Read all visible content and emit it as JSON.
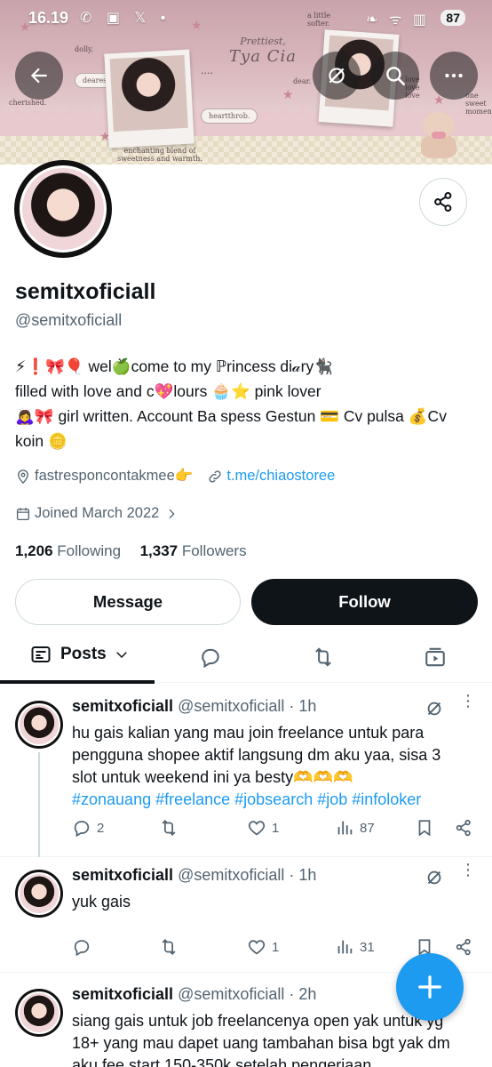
{
  "status_bar": {
    "time": "16.19",
    "battery": "87",
    "left_icons": "✆ ▣ 𝕏 •",
    "right_icons": "❧ ᯤ ▥"
  },
  "banner": {
    "title_line1": "Prettiest,",
    "title_line2": "Tya Cia",
    "texts": {
      "dolly": "dolly.",
      "cherished": "cherished.",
      "dearest": "dearest",
      "a_little_softer": "a little softer.",
      "dear": "dear.",
      "heartthrob": "heartthrob.",
      "enchanting": "enchanting blend of sweetness and warmth.",
      "love": "love love love",
      "one_sweet": "one sweet moment",
      "ellipsis": "...."
    }
  },
  "header": {
    "back_icon": "arrow-left-icon",
    "grok_icon": "grok-icon",
    "search_icon": "search-icon",
    "more_icon": "more-horizontal-icon"
  },
  "profile": {
    "display_name": "semitxoficiall",
    "handle": "@semitxoficiall",
    "bio_line1": "⚡❗🎀🎈 wel🍏come to my ℙrincess di𝒶ry🐈‍⬛",
    "bio_line2": "filled with love and c💖lours 🧁⭐ pink lover",
    "bio_line3": "🙇‍♀️🎀 girl written. Account Ba spess Gestun 💳 Cv pulsa 💰Cv koin 🪙",
    "location": "fastresponcontakmee👉",
    "website": "t.me/chiaostoree",
    "joined": "Joined March 2022",
    "following_count": "1,206",
    "following_label": "Following",
    "followers_count": "1,337",
    "followers_label": "Followers"
  },
  "buttons": {
    "message": "Message",
    "follow": "Follow"
  },
  "tabs": {
    "posts_label": "Posts"
  },
  "posts": [
    {
      "name": "semitxoficiall",
      "handle": "@semitxoficiall",
      "time": "· 1h",
      "text": "hu gais kalian yang mau join freelance untuk para pengguna shopee aktif langsung dm aku yaa, sisa 3 slot untuk weekend ini ya besty🫶🫶🫶",
      "tags": "#zonauang #freelance #jobsearch #job #infoloker",
      "replies": "2",
      "reposts": "",
      "likes": "1",
      "views": "87"
    },
    {
      "name": "semitxoficiall",
      "handle": "@semitxoficiall",
      "time": "· 1h",
      "text": "yuk gais",
      "replies": "",
      "reposts": "",
      "likes": "1",
      "views": "31"
    },
    {
      "name": "semitxoficiall",
      "handle": "@semitxoficiall",
      "time": "· 2h",
      "text": "siang gais untuk job freelancenya open yak untuk yg 18+ yang mau dapet uang tambahan bisa bgt yak dm aku fee start 150-350k setelah pengerjaan"
    }
  ],
  "colors": {
    "accent": "#1d9bf0",
    "text_primary": "#0f1419",
    "text_secondary": "#536471",
    "follow_bg": "#0f1419"
  }
}
